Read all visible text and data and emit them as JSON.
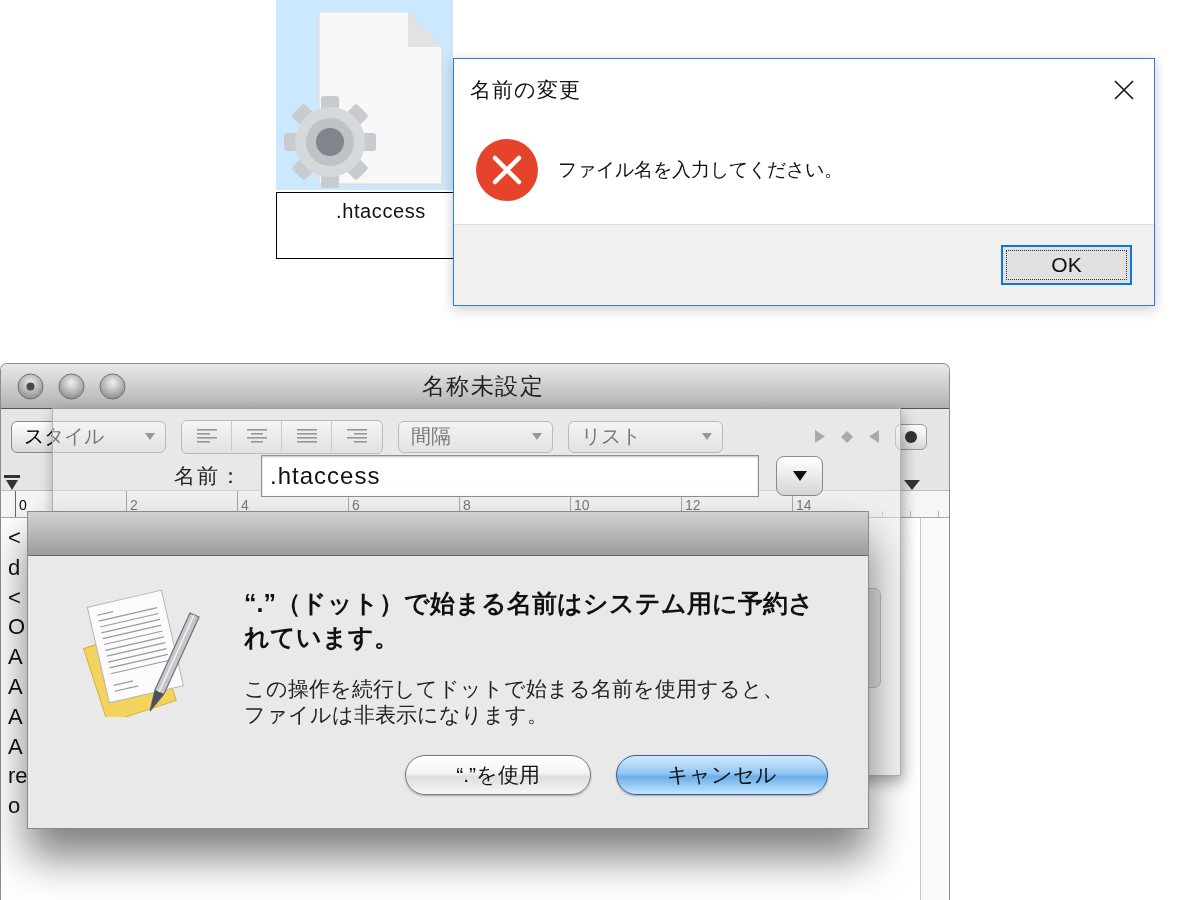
{
  "file": {
    "selected": true,
    "name_field": {
      "value": ".htaccess"
    }
  },
  "rename_dialog": {
    "title": "名前の変更",
    "message": "ファイル名を入力してください。",
    "buttons": [
      {
        "label": "OK",
        "default": true
      }
    ]
  },
  "textedit_window": {
    "title": "名称未設定",
    "edited": true,
    "toolbar": {
      "popups": [
        {
          "label": "スタイル"
        },
        {
          "label": "間隔"
        },
        {
          "label": "リスト"
        }
      ]
    },
    "ruler": {
      "labels": [
        "0",
        "2",
        "4",
        "6",
        "8",
        "10",
        "12",
        "14"
      ]
    },
    "text_lines": [
      "<",
      "d",
      "<",
      "O",
      "A",
      "A",
      "A",
      "A",
      "re",
      "o"
    ]
  },
  "save_sheet": {
    "name_label": "名前：",
    "name_field": {
      "value": ".htaccess"
    }
  },
  "alert": {
    "heading": "“.”（ドット）で始まる名前はシステム用に予約されています。",
    "message": "この操作を続行してドットで始まる名前を使用すると、ファイルは非表示になります。",
    "buttons": [
      {
        "label": "“.”を使用",
        "default": false
      },
      {
        "label": "キャンセル",
        "default": true
      }
    ]
  }
}
